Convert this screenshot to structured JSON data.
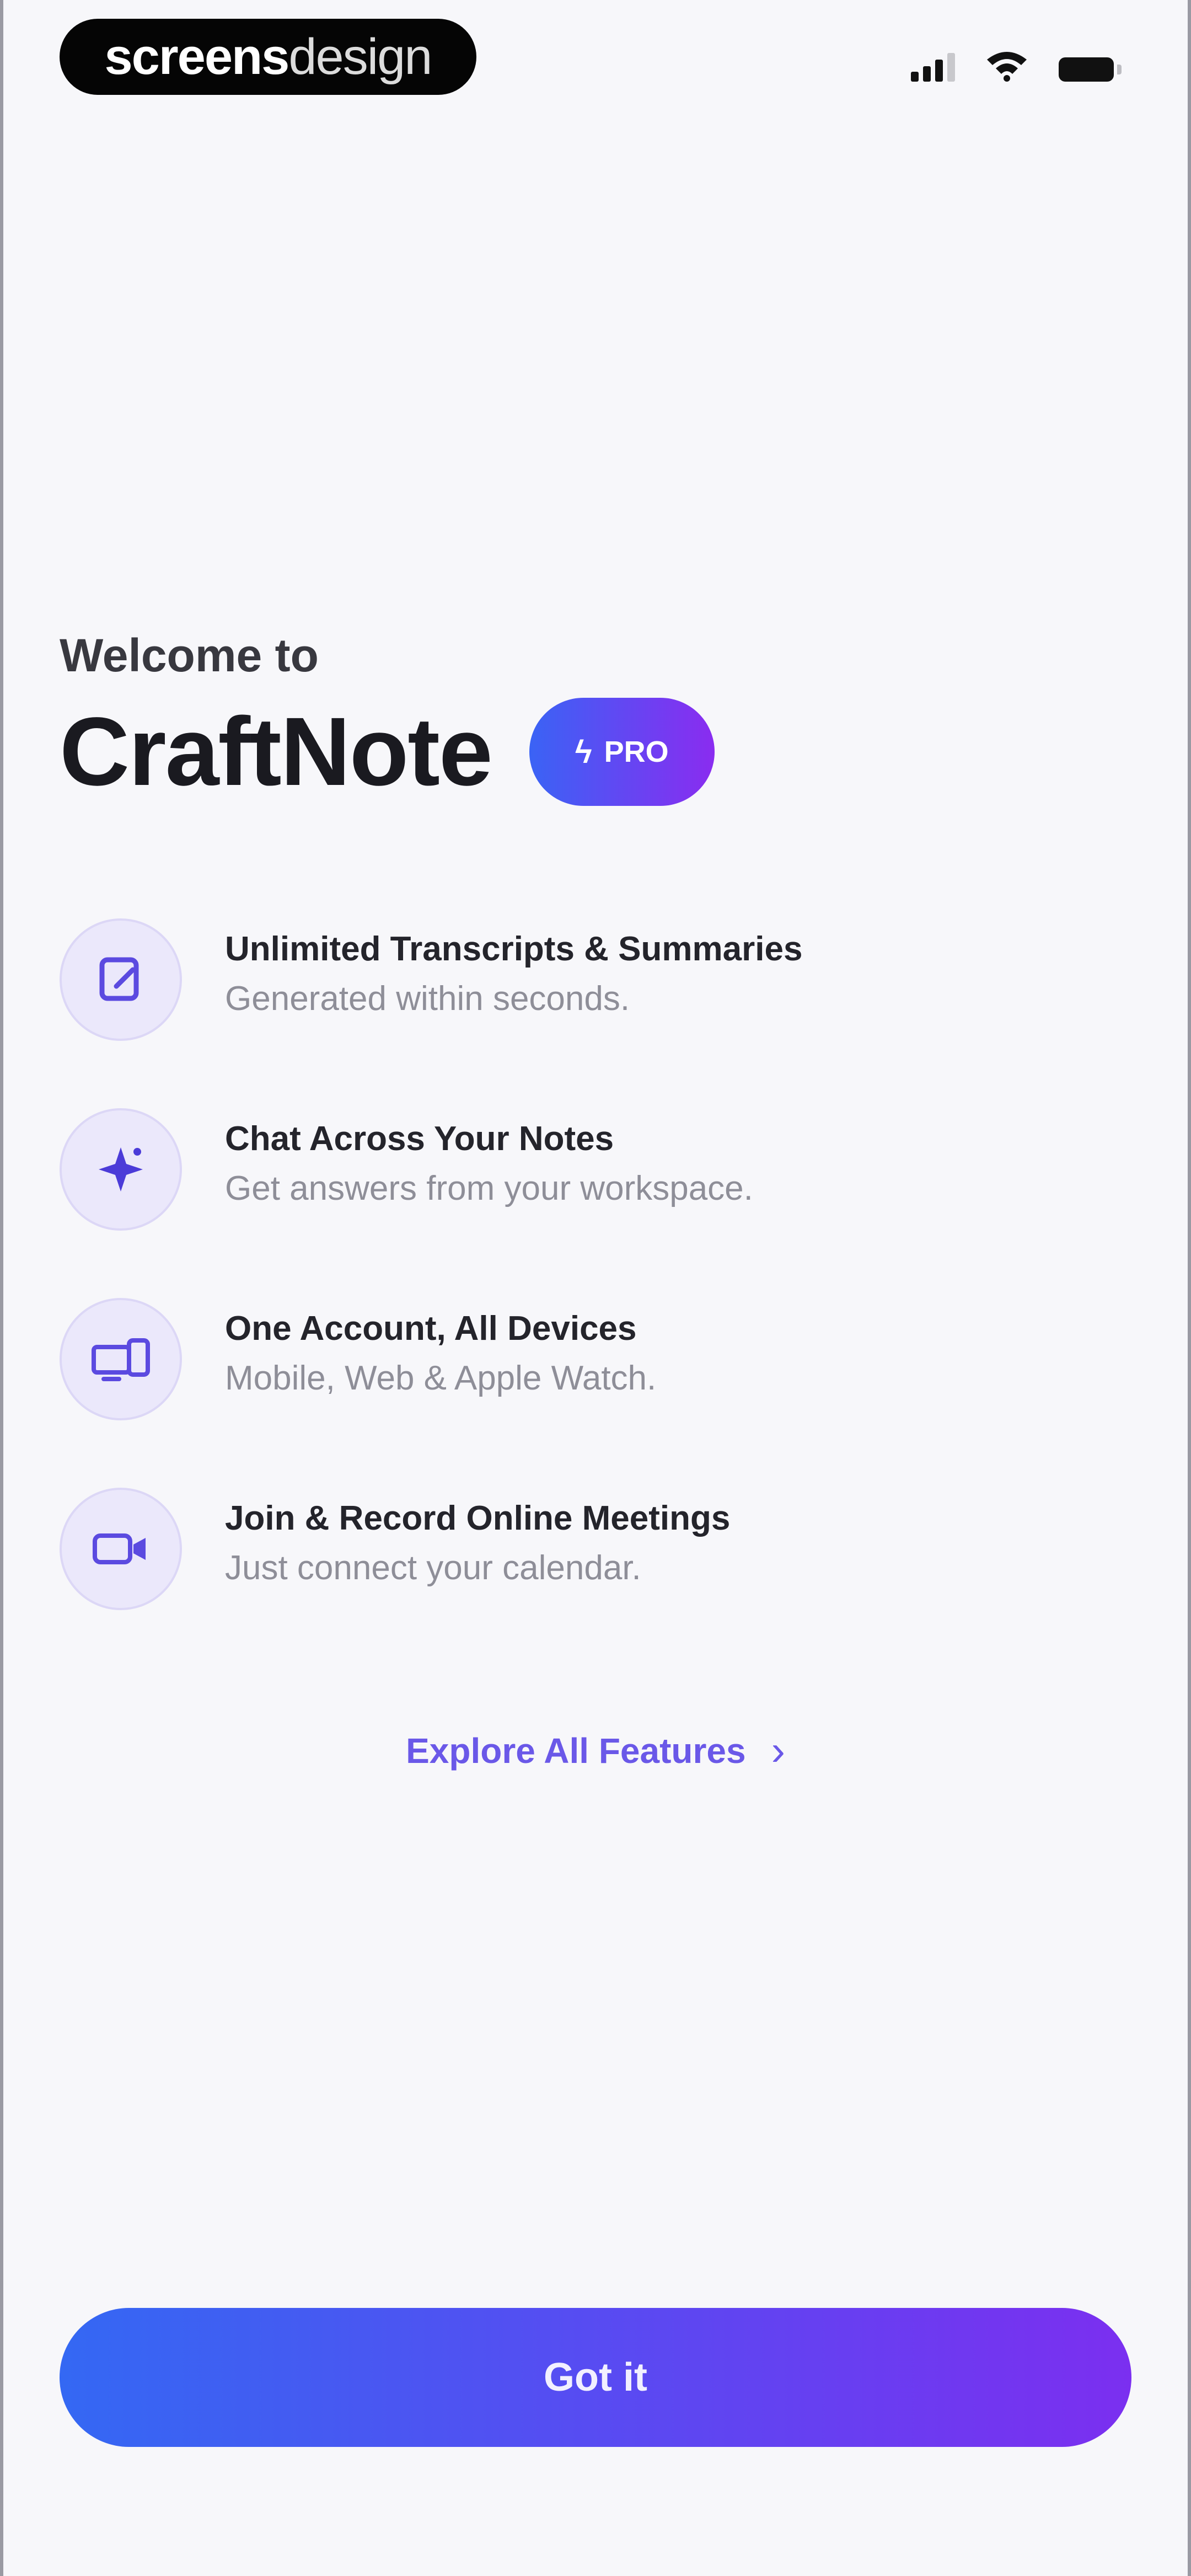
{
  "watermark": {
    "bold_text": "screens",
    "light_text": "design"
  },
  "header": {
    "welcome": "Welcome to",
    "app_name": "CraftNote",
    "badge": "PRO",
    "badge_icon": "bolt-icon"
  },
  "features": [
    {
      "icon": "note-edit-icon",
      "title": "Unlimited Transcripts & Summaries",
      "subtitle": "Generated within seconds."
    },
    {
      "icon": "sparkle-icon",
      "title": "Chat Across Your Notes",
      "subtitle": "Get answers from your workspace."
    },
    {
      "icon": "devices-icon",
      "title": "One Account, All Devices",
      "subtitle": "Mobile, Web & Apple Watch."
    },
    {
      "icon": "video-camera-icon",
      "title": "Join & Record Online Meetings",
      "subtitle": "Just connect your calendar."
    }
  ],
  "explore_link": "Explore All Features",
  "primary_button": "Got it",
  "colors": {
    "background": "#f7f7fa",
    "accent_start": "#3468f3",
    "accent_end": "#7b2ff0",
    "link": "#6a58e8",
    "icon_bg": "#ebe8fb"
  }
}
